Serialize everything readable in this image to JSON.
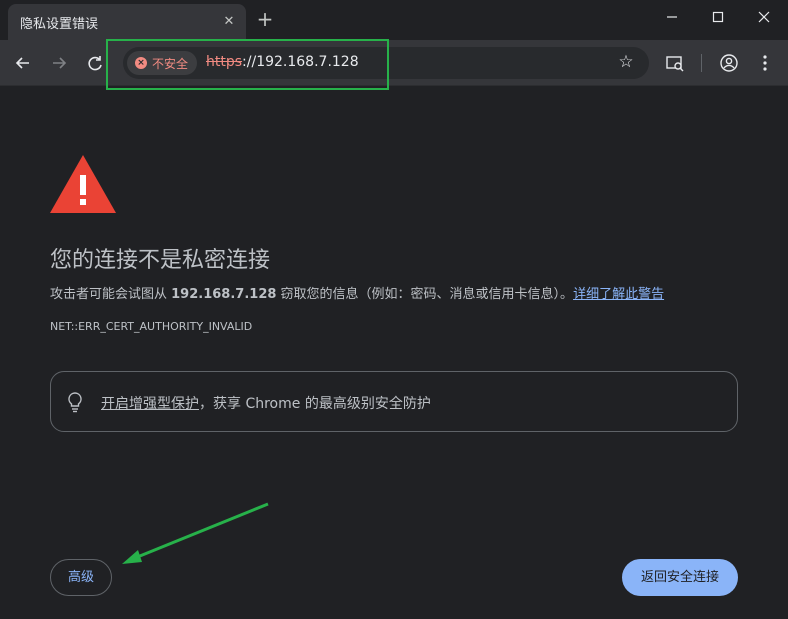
{
  "browser": {
    "tab_title": "隐私设置错误",
    "new_tab": "+",
    "tab_close": "✕",
    "window_controls": {
      "minimize": "—",
      "maximize": "☐",
      "close": "✕"
    }
  },
  "toolbar": {
    "security_label": "不安全",
    "url_scheme": "https",
    "url_rest": "://192.168.7.128",
    "bookmark_icon": "star-icon"
  },
  "page": {
    "heading": "您的连接不是私密连接",
    "desc_prefix": "攻击者可能会试图从 ",
    "desc_host": "192.168.7.128",
    "desc_middle": " 窃取您的信息（例如：密码、消息或信用卡信息）。",
    "desc_link": "详细了解此警告",
    "error_code": "NET::ERR_CERT_AUTHORITY_INVALID",
    "protection_link": "开启增强型保护",
    "protection_rest": "，获享 Chrome 的最高级别安全防护",
    "advanced_button": "高级",
    "back_button": "返回安全连接"
  },
  "colors": {
    "background": "#202124",
    "link": "#8ab4f8",
    "warning_red": "#ea4335",
    "insecure_red": "#f28b82",
    "annotation_green": "#27b14a"
  }
}
